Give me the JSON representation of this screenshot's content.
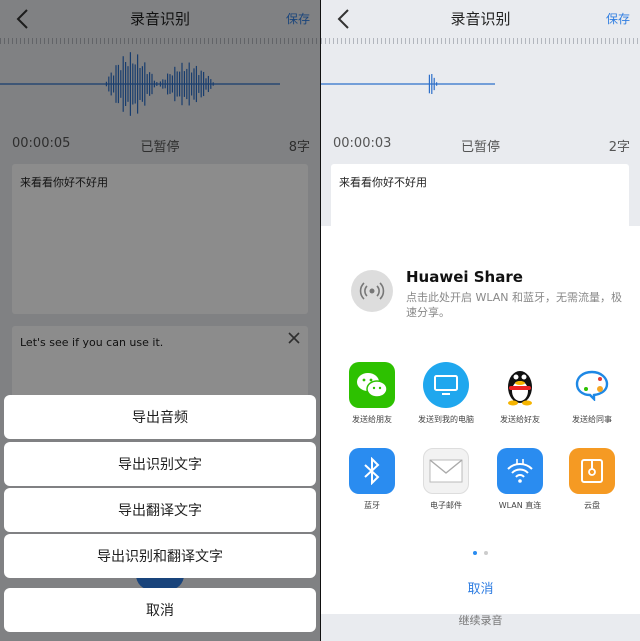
{
  "left": {
    "title": "录音识别",
    "save_label": "保存",
    "time": "00:00:05",
    "status": "已暂停",
    "char_count": "8字",
    "transcript": "来看看你好不好用",
    "translation": "Let's see if you can use it.",
    "sheet_actions": [
      "导出音频",
      "导出识别文字",
      "导出翻译文字",
      "导出识别和翻译文字"
    ],
    "cancel_label": "取消"
  },
  "right": {
    "title": "录音识别",
    "save_label": "保存",
    "time": "00:00:03",
    "status": "已暂停",
    "char_count": "2字",
    "transcript": "来看看你好不好用",
    "huawei_share": {
      "title": "Huawei Share",
      "desc": "点击此处开启 WLAN 和蓝牙，无需流量，极速分享。"
    },
    "apps": [
      {
        "label": "发送给朋友",
        "icon": "wechat-icon",
        "color": "#2dc100"
      },
      {
        "label": "发送到我的电脑",
        "icon": "computer-icon",
        "color": "#1fa7ee"
      },
      {
        "label": "发送给好友",
        "icon": "qq-icon",
        "color": "#ffffff"
      },
      {
        "label": "发送给同事",
        "icon": "chat-bubble-icon",
        "color": "#ffffff"
      },
      {
        "label": "蓝牙",
        "icon": "bluetooth-icon",
        "color": "#2a8cf0"
      },
      {
        "label": "电子邮件",
        "icon": "email-icon",
        "color": "#f2f2f2"
      },
      {
        "label": "WLAN 直连",
        "icon": "wlan-icon",
        "color": "#2a8cf0"
      },
      {
        "label": "云盘",
        "icon": "cloud-drive-icon",
        "color": "#f59a23"
      }
    ],
    "cancel_label": "取消",
    "bottom_hint": "继续录音"
  },
  "colors": {
    "accent": "#2f7de1",
    "wave": "#2d6fc9"
  }
}
